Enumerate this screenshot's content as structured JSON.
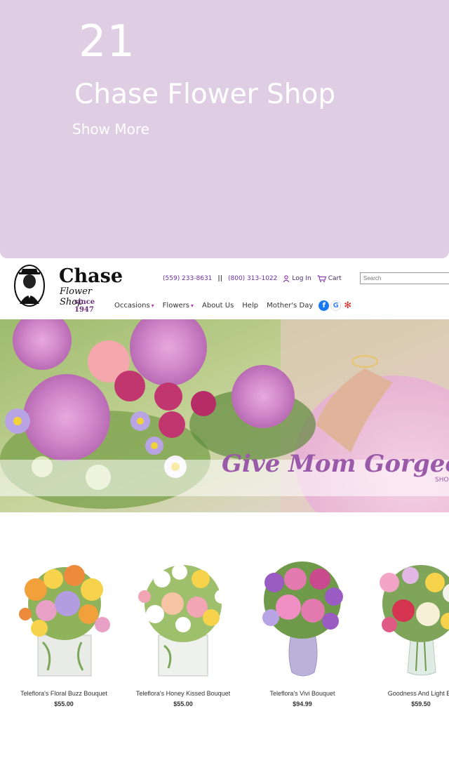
{
  "card": {
    "number": "21",
    "title": "Chase Flower Shop",
    "show_more": "Show More",
    "background": "#dfcde4"
  },
  "site": {
    "logo": {
      "line1": "Chase",
      "line2": "Flower Shop",
      "line3": "since 1947"
    },
    "topbar": {
      "phone1": "(559) 233-8631",
      "separator": "||",
      "phone2": "(800) 313-1022",
      "login": "Log In",
      "cart": "Cart",
      "search_placeholder": "Search",
      "accent": "#6b2fa0"
    },
    "nav": {
      "occasions": "Occasions",
      "flowers": "Flowers",
      "about": "About Us",
      "help": "Help",
      "mothers_day": "Mother's Day"
    },
    "social_icons": [
      "facebook-icon",
      "google-icon",
      "yelp-icon"
    ],
    "hero": {
      "headline": "Give Mom Gorgeous",
      "tail": "SHO"
    },
    "products": [
      {
        "name": "Teleflora's Floral Buzz Bouquet",
        "price": "$55.00"
      },
      {
        "name": "Teleflora's Honey Kissed Bouquet",
        "price": "$55.00"
      },
      {
        "name": "Teleflora's Vivi Bouquet",
        "price": "$94.99"
      },
      {
        "name": "Goodness And Light Bo",
        "price": "$59.50"
      }
    ]
  }
}
